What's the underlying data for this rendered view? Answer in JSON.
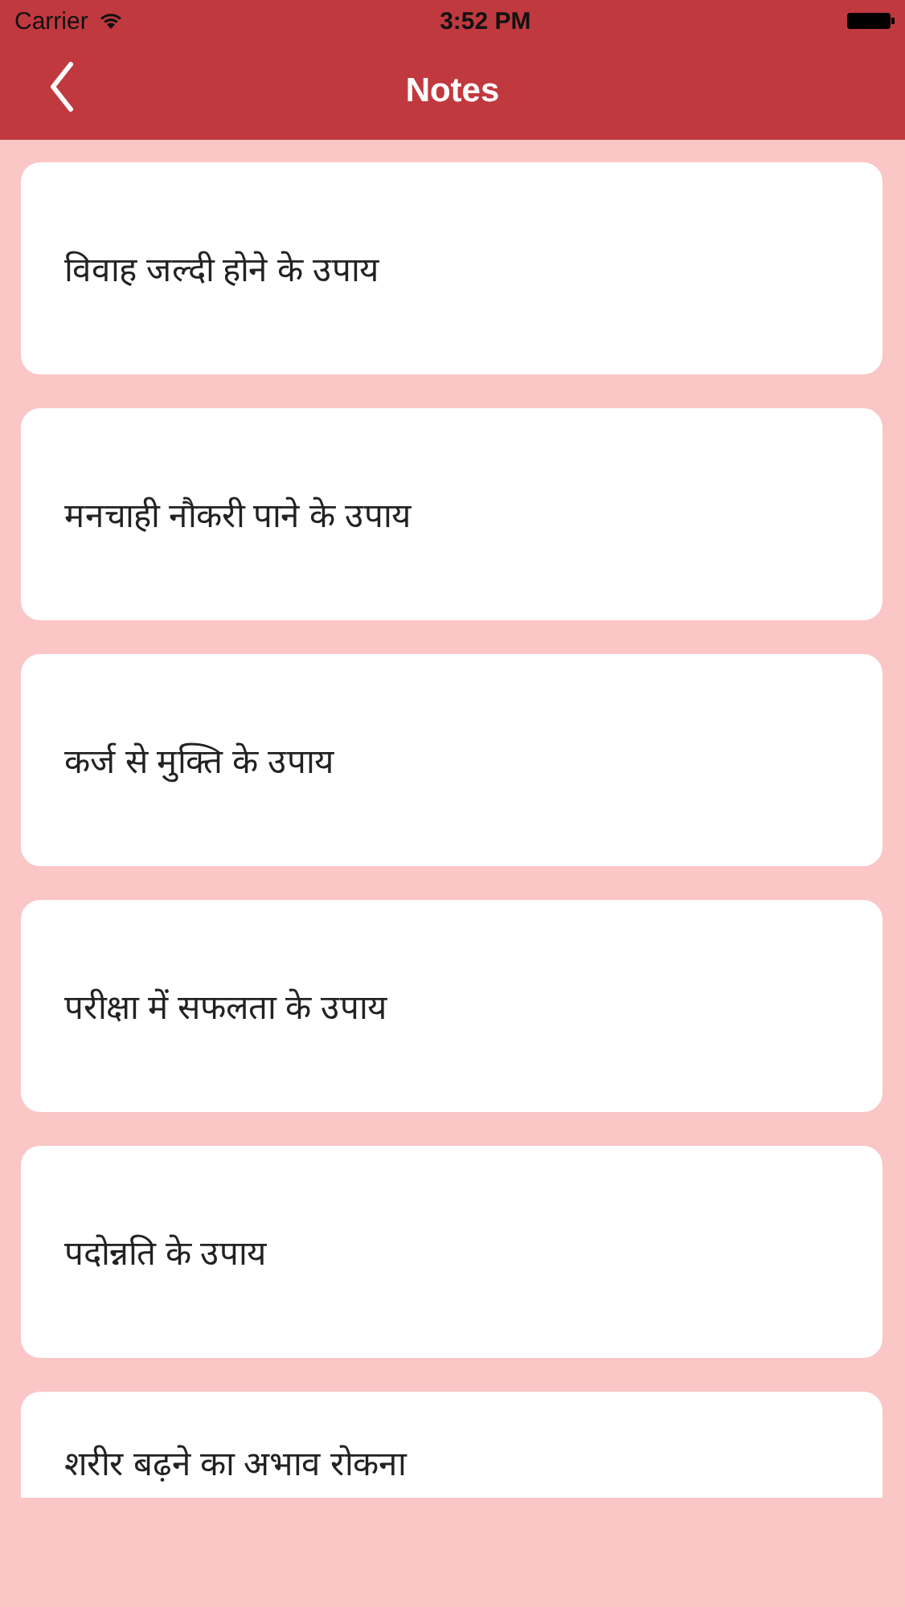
{
  "status_bar": {
    "carrier": "Carrier",
    "time": "3:52 PM"
  },
  "nav": {
    "title": "Notes"
  },
  "notes": [
    {
      "title": "विवाह जल्दी होने के उपाय"
    },
    {
      "title": "मनचाही नौकरी पाने के उपाय"
    },
    {
      "title": "कर्ज से मुक्ति के उपाय"
    },
    {
      "title": "परीक्षा में सफलता के उपाय"
    },
    {
      "title": "पदोन्नति के उपाय"
    },
    {
      "title": "शरीर बढ़ने का अभाव रोकना"
    }
  ]
}
